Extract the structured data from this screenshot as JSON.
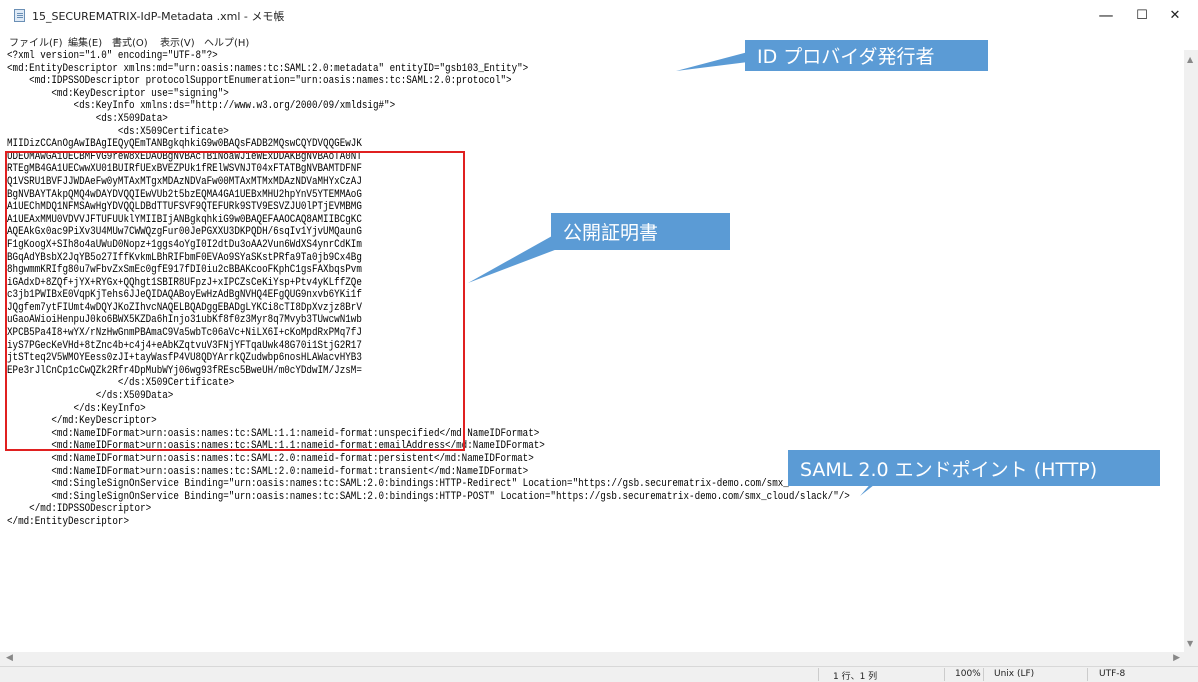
{
  "window": {
    "title": "15_SECUREMATRIX-IdP-Metadata .xml - メモ帳",
    "minimize": "—",
    "maximize": "☐",
    "close": "✕"
  },
  "menu": [
    "ファイル(F)",
    "編集(E)",
    "書式(O)",
    "表示(V)",
    "ヘルプ(H)"
  ],
  "code": [
    "<?xml version=\"1.0\" encoding=\"UTF-8\"?>",
    "<md:EntityDescriptor xmlns:md=\"urn:oasis:names:tc:SAML:2.0:metadata\" entityID=\"gsb103_Entity\">",
    "    <md:IDPSSODescriptor protocolSupportEnumeration=\"urn:oasis:names:tc:SAML:2.0:protocol\">",
    "        <md:KeyDescriptor use=\"signing\">",
    "            <ds:KeyInfo xmlns:ds=\"http://www.w3.org/2000/09/xmldsig#\">",
    "                <ds:X509Data>",
    "                    <ds:X509Certificate>",
    "MIIDizCCAnOgAwIBAgIEQyQEmTANBgkqhkiG9w0BAQsFADB2MQswCQYDVQQGEwJK",
    "UDEOMAwGA1UECBMFVG9reW8xEDAOBgNVBAcTB1NoaWJ1eWExDDAKBgNVBAoTA0NT",
    "RTEgMB4GA1UECwwXU01BUIRfUExBVEZPUk1fRElWSVNJT04xFTATBgNVBAMTDFNF",
    "Q1VSRU1BVFJJWDAeFw0yMTAxMTgxMDAzNDVaFw00MTAxMTMxMDAzNDVaMHYxCzAJ",
    "BgNVBAYTAkpQMQ4wDAYDVQQIEwVUb2t5bzEQMA4GA1UEBxMHU2hpYnV5YTEMMAoG",
    "A1UEChMDQ1NFMSAwHgYDVQQLDBdTTUFSVF9QTEFURk9STV9ESVZJU0lPTjEVMBMG",
    "A1UEAxMMU0VDVVJFTUFUUklYMIIBIjANBgkqhkiG9w0BAQEFAAOCAQ8AMIIBCgKC",
    "AQEAkGx0ac9PiXv3U4MUw7CWWQzgFur00JePGXXU3DKPQDH/6sqIv1YjvUMQaunG",
    "F1gKoogX+SIh8o4aUWuD0Nopz+1ggs4oYgI0I2dtDu3oAA2Vun6WdXS4ynrCdKIm",
    "BGqAdYBsbX2JqYB5o27IffKvkmLBhRIFbmF0EVAo9SYaSKstPRfa9Ta0jb9Cx4Bg",
    "8hgwmmKRIfg80u7wFbvZxSmEc0gfE917fDI0iu2cBBAKcooFKphC1gsFAXbqsPvm",
    "iGAdxD+8ZQf+jYX+RYGx+QQhgt1SBIR8UFpzJ+xIPCZsCeKiYsp+Ptv4yKLffZQe",
    "c3jb1PWIBxE0VqpKjTehs6JJeQIDAQABoyEwHzAdBgNVHQ4EFgQUG9nxvb6YKi1f",
    "JQgfem7ytFIUmt4wDQYJKoZIhvcNAQELBQADggEBADgLYKCi8cTI8DpXvzjz8BrV",
    "uGaoAWioiHenpuJ0ko6BWX5KZDa6hInjo31ubKf8f0z3Myr8q7Mvyb3TUwcwN1wb",
    "XPCB5Pa4I8+wYX/rNzHwGnmPBAmaC9Va5wbTc06aVc+NiLX6I+cKoMpdRxPMq7fJ",
    "iyS7PGecKeVHd+8tZnc4b+c4j4+eAbKZqtvuV3FNjYFTqaUwk48G70i1StjG2R17",
    "jtSTteq2V5WMOYEess0zJI+tayWasfP4VU8QDYArrkQZudwbp6nosHLAWacvHYB3",
    "EPe3rJlCnCp1cCwQZk2Rfr4DpMubWYj06wg93fREsc5BweUH/m0cYDdwIM/JzsM=",
    "                    </ds:X509Certificate>",
    "                </ds:X509Data>",
    "            </ds:KeyInfo>",
    "        </md:KeyDescriptor>",
    "        <md:NameIDFormat>urn:oasis:names:tc:SAML:1.1:nameid-format:unspecified</md:NameIDFormat>",
    "        <md:NameIDFormat>urn:oasis:names:tc:SAML:1.1:nameid-format:emailAddress</md:NameIDFormat>",
    "        <md:NameIDFormat>urn:oasis:names:tc:SAML:2.0:nameid-format:persistent</md:NameIDFormat>",
    "        <md:NameIDFormat>urn:oasis:names:tc:SAML:2.0:nameid-format:transient</md:NameIDFormat>",
    "        <md:SingleSignOnService Binding=\"urn:oasis:names:tc:SAML:2.0:bindings:HTTP-Redirect\" Location=\"https://gsb.securematrix-demo.com/smx_cloud/slack/\"/>",
    "        <md:SingleSignOnService Binding=\"urn:oasis:names:tc:SAML:2.0:bindings:HTTP-POST\" Location=\"https://gsb.securematrix-demo.com/smx_cloud/slack/\"/>",
    "    </md:IDPSSODescriptor>",
    "</md:EntityDescriptor>"
  ],
  "callouts": {
    "issuer": "ID プロバイダ発行者",
    "certificate": "公開証明書",
    "endpoint": "SAML 2.0 エンドポイント (HTTP)"
  },
  "callout_color": "#5b9bd5",
  "highlight_color": "#e02020",
  "status": {
    "position": "1 行、1 列",
    "zoom": "100%",
    "line_ending": "Unix (LF)",
    "encoding": "UTF-8"
  }
}
